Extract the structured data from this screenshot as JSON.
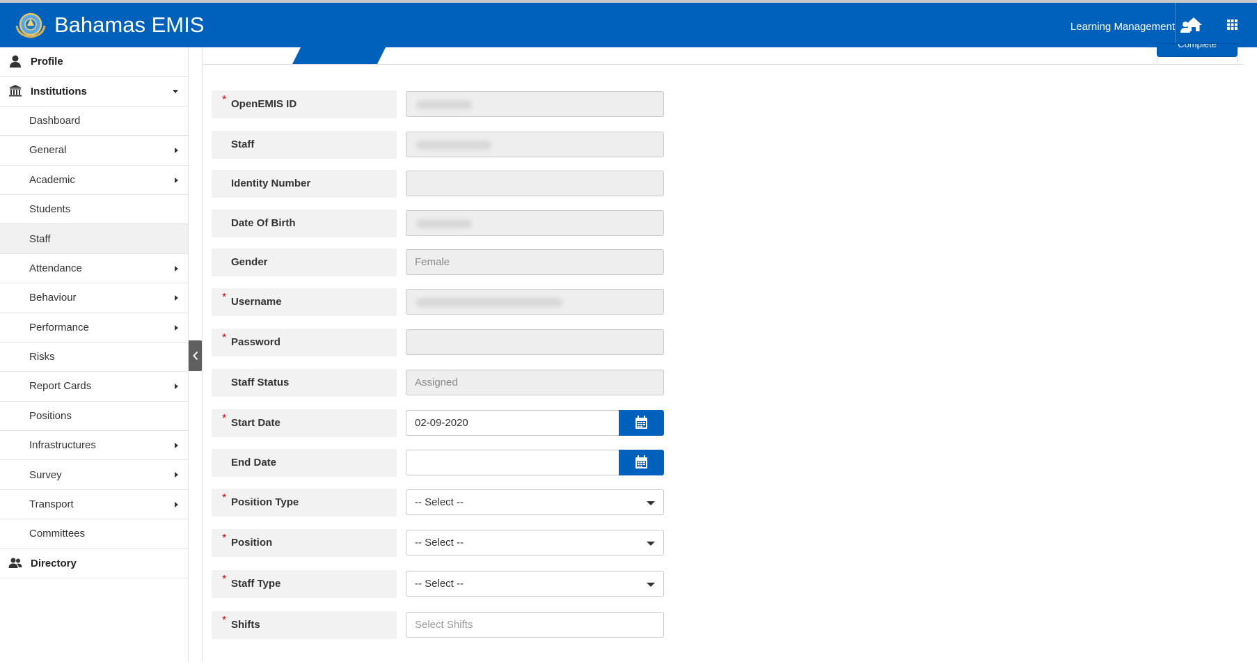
{
  "app": {
    "brand_title": "Bahamas EMIS",
    "user_label": "Learning Management",
    "accent_color": "#0061bd"
  },
  "sidebar": {
    "profile": "Profile",
    "institutions": "Institutions",
    "items": [
      {
        "label": "Dashboard",
        "has_submenu": false
      },
      {
        "label": "General",
        "has_submenu": true
      },
      {
        "label": "Academic",
        "has_submenu": true
      },
      {
        "label": "Students",
        "has_submenu": false
      },
      {
        "label": "Staff",
        "has_submenu": false,
        "active": true
      },
      {
        "label": "Attendance",
        "has_submenu": true
      },
      {
        "label": "Behaviour",
        "has_submenu": true
      },
      {
        "label": "Performance",
        "has_submenu": true
      },
      {
        "label": "Risks",
        "has_submenu": false
      },
      {
        "label": "Report Cards",
        "has_submenu": true
      },
      {
        "label": "Positions",
        "has_submenu": false
      },
      {
        "label": "Infrastructures",
        "has_submenu": true
      },
      {
        "label": "Survey",
        "has_submenu": true
      },
      {
        "label": "Transport",
        "has_submenu": true
      },
      {
        "label": "Committees",
        "has_submenu": false
      }
    ],
    "directory": "Directory"
  },
  "toolbar": {
    "complete_label": "Complete"
  },
  "form": {
    "openemis_id": {
      "label": "OpenEMIS ID",
      "required": true,
      "value": ""
    },
    "staff": {
      "label": "Staff",
      "required": false,
      "value": ""
    },
    "identity_number": {
      "label": "Identity Number",
      "required": false,
      "value": ""
    },
    "date_of_birth": {
      "label": "Date Of Birth",
      "required": false,
      "value": ""
    },
    "gender": {
      "label": "Gender",
      "required": false,
      "value": "Female"
    },
    "username": {
      "label": "Username",
      "required": true,
      "value": ""
    },
    "password": {
      "label": "Password",
      "required": true,
      "value": ""
    },
    "staff_status": {
      "label": "Staff Status",
      "required": false,
      "value": "Assigned"
    },
    "start_date": {
      "label": "Start Date",
      "required": true,
      "value": "02-09-2020"
    },
    "end_date": {
      "label": "End Date",
      "required": false,
      "value": ""
    },
    "position_type": {
      "label": "Position Type",
      "required": true,
      "value": "-- Select --"
    },
    "position": {
      "label": "Position",
      "required": true,
      "value": "-- Select --"
    },
    "staff_type": {
      "label": "Staff Type",
      "required": true,
      "value": "-- Select --"
    },
    "shifts": {
      "label": "Shifts",
      "required": true,
      "placeholder": "Select Shifts"
    }
  }
}
